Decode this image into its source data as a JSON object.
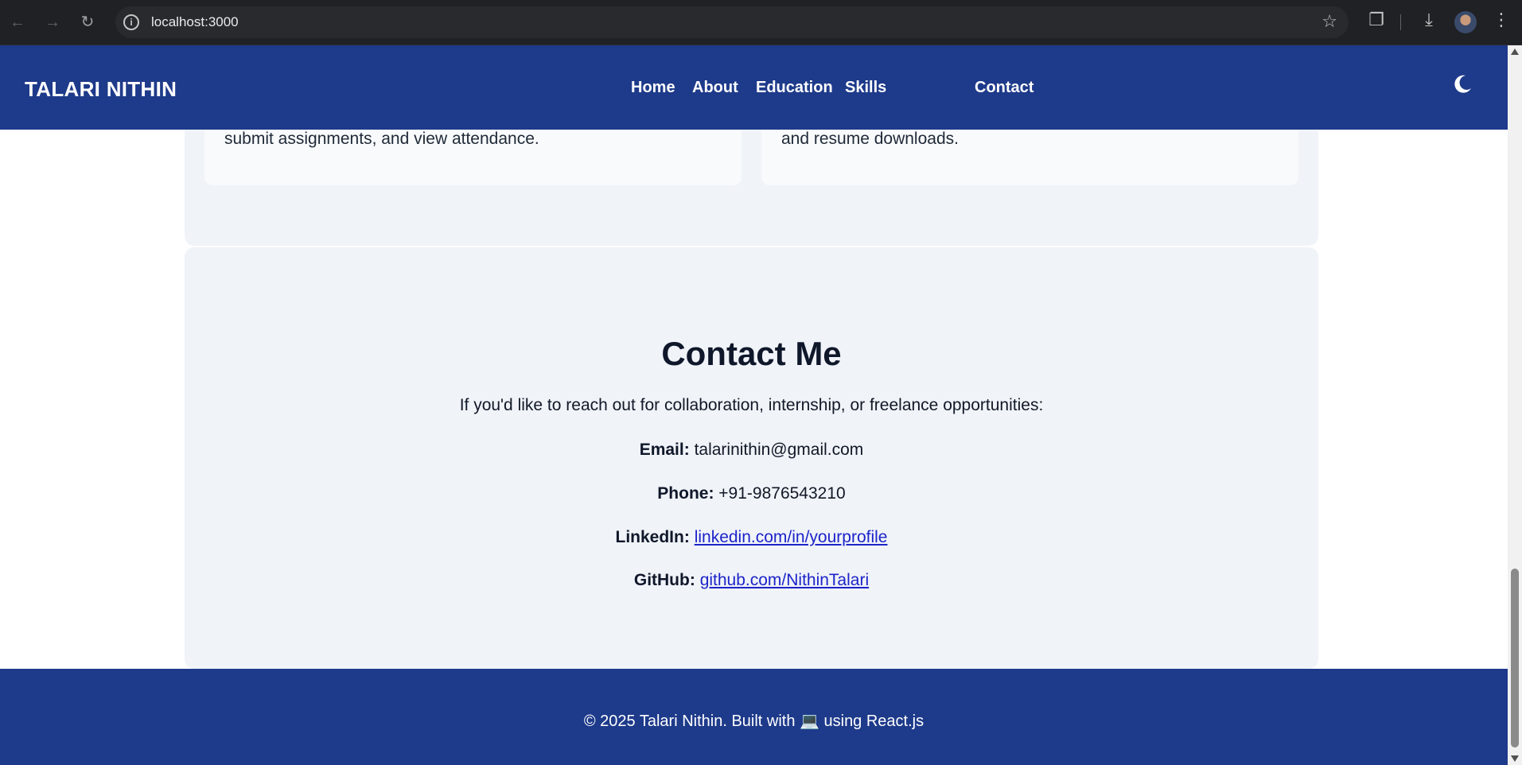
{
  "browser": {
    "url": "localhost:3000"
  },
  "header": {
    "brand": "TALARI NITHIN",
    "nav": [
      "Home",
      "About",
      "Education",
      "Skills",
      "Contact"
    ],
    "theme_toggle_icon": "moon-icon"
  },
  "projects": {
    "card1_text": "submit assignments, and view attendance.",
    "card2_text": "and resume downloads."
  },
  "contact": {
    "title": "Contact Me",
    "intro": "If you'd like to reach out for collaboration, internship, or freelance opportunities:",
    "email_label": "Email:",
    "email_value": "talarinithin@gmail.com",
    "phone_label": "Phone:",
    "phone_value": "+91-9876543210",
    "linkedin_label": "LinkedIn:",
    "linkedin_value": "linkedin.com/in/yourprofile",
    "github_label": "GitHub:",
    "github_value": "github.com/NithinTalari"
  },
  "footer": {
    "text": "© 2025 Talari Nithin. Built with 💻 using React.js"
  },
  "colors": {
    "primary": "#1e3a8a",
    "section_bg": "#f0f3f8",
    "link": "#1d24c9"
  }
}
